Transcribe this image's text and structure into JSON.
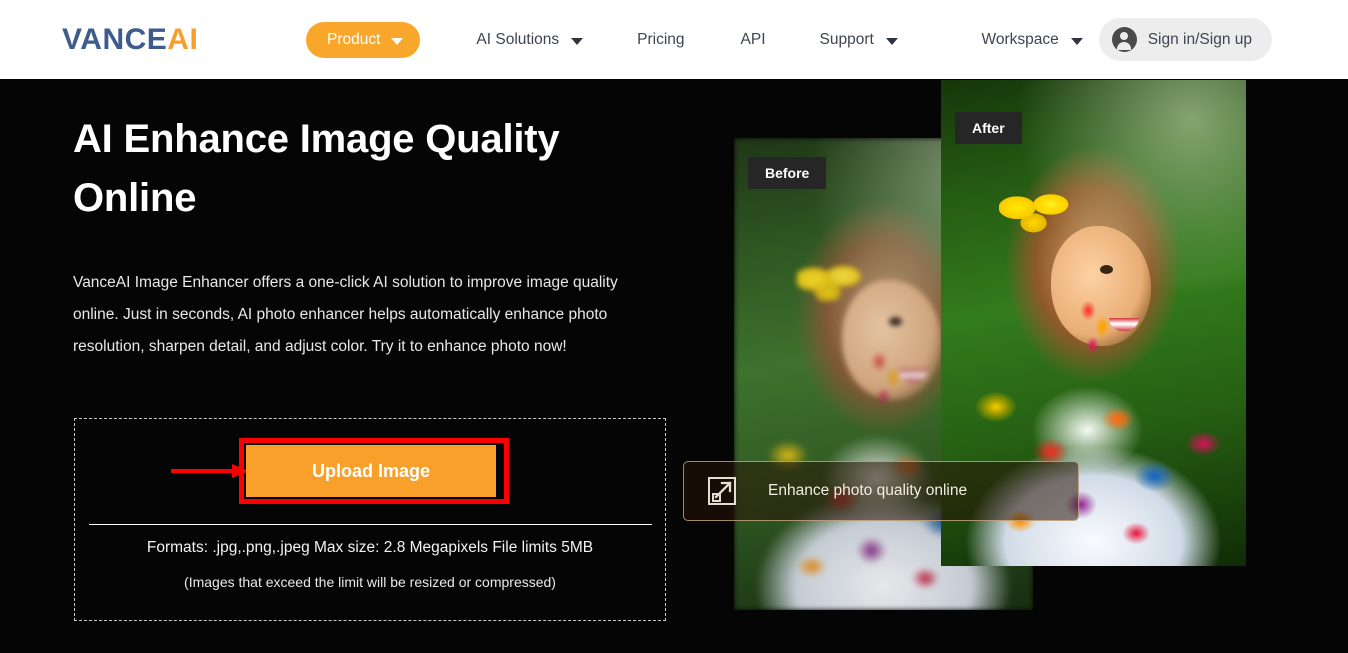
{
  "header": {
    "logo": {
      "part1": "VANCE",
      "part2": "AI"
    },
    "nav": [
      {
        "label": "Product",
        "has_caret": true,
        "style": "pill"
      },
      {
        "label": "AI Solutions",
        "has_caret": true,
        "style": "plain"
      },
      {
        "label": "Pricing",
        "has_caret": false,
        "style": "plain"
      },
      {
        "label": "API",
        "has_caret": false,
        "style": "plain"
      },
      {
        "label": "Support",
        "has_caret": true,
        "style": "plain"
      }
    ],
    "workspace": {
      "label": "Workspace",
      "has_caret": true
    },
    "signin": {
      "label": "Sign in/Sign up",
      "icon": "user-avatar-icon"
    },
    "colors": {
      "logo_blue": "#3d5b8c",
      "logo_orange": "#f5a02e",
      "pill_orange": "#f9a72b",
      "signin_bg": "#ededed",
      "nav_text": "#3f4450",
      "header_bg": "#ffffff"
    }
  },
  "hero": {
    "title": "AI Enhance Image Quality Online",
    "description": "VanceAI Image Enhancer offers a one-click AI solution to improve image quality online. Just in seconds, AI photo enhancer helps automatically enhance photo resolution, sharpen detail, and adjust color. Try it to enhance photo now!",
    "background": "#050505"
  },
  "upload": {
    "button_label": "Upload Image",
    "formats_text": "Formats: .jpg,.png,.jpeg Max size: 2.8 Megapixels File limits 5MB",
    "note_text": "(Images that exceed the limit will be resized or compressed)",
    "colors": {
      "button_bg": "#f9a02b",
      "button_text": "#ffffff",
      "annotation_red": "#fa0000",
      "dashed_border": "#c9c9c9"
    }
  },
  "comparison": {
    "before_label": "Before",
    "after_label": "After",
    "badge_bg": "#262626",
    "overlay": {
      "label": "Enhance photo quality online",
      "icon": "expand-arrow-icon"
    }
  }
}
